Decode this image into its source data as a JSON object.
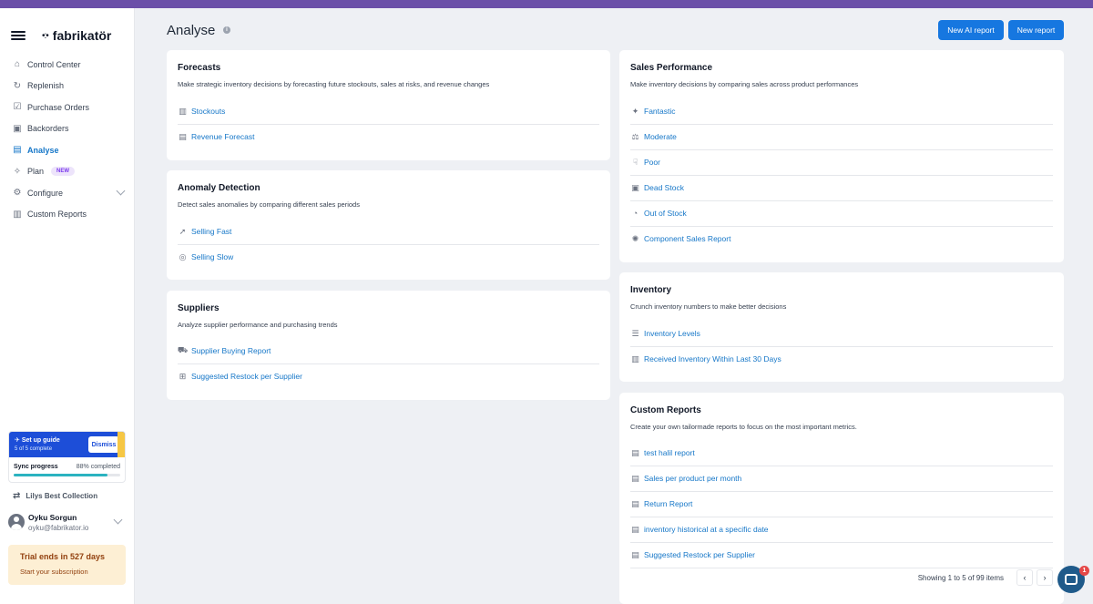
{
  "brand": {
    "name": "fabrikatör",
    "dots": "•:•"
  },
  "sidebar": {
    "items": [
      {
        "label": "Control Center",
        "icon": "home-icon",
        "glyph": "⌂"
      },
      {
        "label": "Replenish",
        "icon": "refresh-icon",
        "glyph": "↻"
      },
      {
        "label": "Purchase Orders",
        "icon": "clipboard-icon",
        "glyph": "☑"
      },
      {
        "label": "Backorders",
        "icon": "box-icon",
        "glyph": "▣"
      },
      {
        "label": "Analyse",
        "icon": "chart-icon",
        "glyph": "▤"
      },
      {
        "label": "Plan",
        "icon": "wand-icon",
        "glyph": "✧",
        "badge": "NEW"
      },
      {
        "label": "Configure",
        "icon": "sliders-icon",
        "glyph": "⚙"
      },
      {
        "label": "Custom Reports",
        "icon": "bar-chart-icon",
        "glyph": "▥"
      }
    ],
    "setup": {
      "title": "Set up guide",
      "progress": "5 of 5 complete",
      "dismiss": "Dismiss"
    },
    "sync": {
      "label": "Sync progress",
      "value": "88% completed",
      "fraction": 0.88
    },
    "store": "Lilys Best Collection",
    "user": {
      "name": "Oyku Sorgun",
      "email": "oyku@fabrikator.io"
    },
    "trial": {
      "title": "Trial ends in 527 days",
      "subtitle": "Start your subscription"
    }
  },
  "header": {
    "title": "Analyse",
    "info": "i",
    "new_ai_report": "New AI report",
    "new_report": "New report"
  },
  "cards": {
    "forecasts": {
      "title": "Forecasts",
      "desc": "Make strategic inventory decisions by forecasting future stockouts, sales at risks, and revenue changes",
      "links": [
        "Stockouts",
        "Revenue Forecast"
      ]
    },
    "anomaly": {
      "title": "Anomaly Detection",
      "desc": "Detect sales anomalies by comparing different sales periods",
      "links": [
        "Selling Fast",
        "Selling Slow"
      ]
    },
    "suppliers": {
      "title": "Suppliers",
      "desc": "Analyze supplier performance and purchasing trends",
      "links": [
        "Supplier Buying Report",
        "Suggested Restock per Supplier"
      ]
    },
    "sales": {
      "title": "Sales Performance",
      "desc": "Make inventory decisions by comparing sales across product performances",
      "links": [
        "Fantastic",
        "Moderate",
        "Poor",
        "Dead Stock",
        "Out of Stock",
        "Component Sales Report"
      ]
    },
    "inventory": {
      "title": "Inventory",
      "desc": "Crunch inventory numbers to make better decisions",
      "links": [
        "Inventory Levels",
        "Received Inventory Within Last 30 Days"
      ]
    },
    "custom": {
      "title": "Custom Reports",
      "desc": "Create your own tailormade reports to focus on the most important metrics.",
      "links": [
        "test halil report",
        "Sales per product per month",
        "Return Report",
        "inventory historical at a specific date",
        "Suggested Restock per Supplier"
      ],
      "pager": "Showing 1 to 5 of 99 items",
      "prev": "‹",
      "next": "›"
    }
  },
  "chat": {
    "badge": "1"
  }
}
